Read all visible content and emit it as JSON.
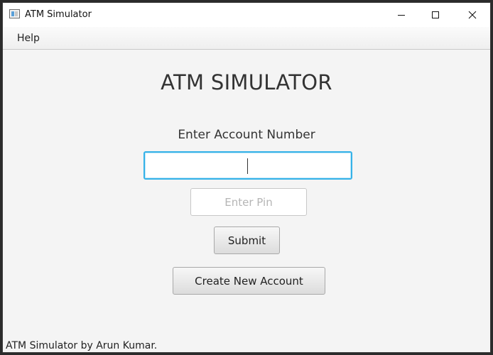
{
  "window": {
    "title": "ATM Simulator",
    "app_icon": "window-app-icon",
    "controls": [
      "minimize-icon",
      "maximize-icon",
      "close-icon"
    ]
  },
  "menubar": {
    "items": [
      {
        "label": "Help"
      }
    ]
  },
  "main": {
    "heading": "ATM SIMULATOR",
    "account_prompt": "Enter Account Number",
    "account_input": {
      "value": "",
      "placeholder": ""
    },
    "pin_input": {
      "value": "",
      "placeholder": "Enter Pin"
    },
    "submit_label": "Submit",
    "create_account_label": "Create New Account"
  },
  "footer": {
    "text": "ATM Simulator by Arun Kumar."
  },
  "colors": {
    "focus_border": "#35b2e8",
    "background": "#f4f4f4"
  }
}
